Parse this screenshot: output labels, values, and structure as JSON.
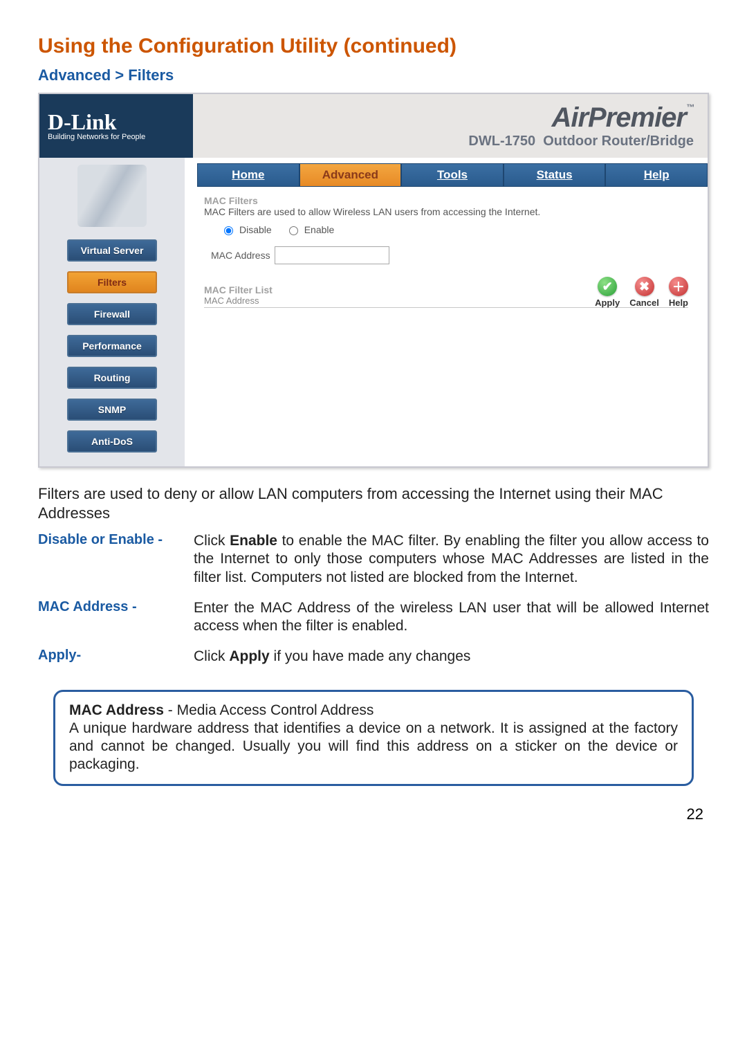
{
  "page_title": "Using the Configuration Utility (continued)",
  "breadcrumb": "Advanced > Filters",
  "logo": {
    "main": "D-Link",
    "sub": "Building Networks for People"
  },
  "brand": {
    "line1": "AirPremier",
    "model": "DWL-1750",
    "desc": "Outdoor Router/Bridge"
  },
  "tabs": [
    "Home",
    "Advanced",
    "Tools",
    "Status",
    "Help"
  ],
  "active_tab": "Advanced",
  "sidebar": [
    "Virtual Server",
    "Filters",
    "Firewall",
    "Performance",
    "Routing",
    "SNMP",
    "Anti-DoS"
  ],
  "sidebar_active": "Filters",
  "mac": {
    "heading": "MAC Filters",
    "desc": "MAC Filters are used to allow Wireless LAN users from accessing the Internet.",
    "disable": "Disable",
    "enable": "Enable",
    "addr_label": "MAC Address",
    "list_heading": "MAC Filter List",
    "list_sub": "MAC Address"
  },
  "actions": {
    "apply": "Apply",
    "cancel": "Cancel",
    "help": "Help"
  },
  "intro": "Filters are used to deny or allow LAN computers from accessing the Internet using their MAC Addresses",
  "defs": {
    "de_label": "Disable or Enable -",
    "de_text_a": "Click ",
    "de_text_bold": "Enable",
    "de_text_b": " to enable the MAC filter. By enabling the filter you allow access to the Internet to only those computers whose MAC Addresses are listed in the filter list. Computers not listed are blocked from the Internet.",
    "mac_label": "MAC Address -",
    "mac_text": "Enter the MAC Address of the wireless LAN user that will be allowed Internet access when the filter is enabled.",
    "apply_label": "Apply-",
    "apply_text_a": "Click ",
    "apply_text_bold": "Apply",
    "apply_text_b": " if you have made any changes"
  },
  "infobox": {
    "bold": "MAC Address",
    "rest": " - Media Access Control Address",
    "body": "A unique hardware address that identifies a device on a network. It is assigned at the factory and cannot be changed. Usually you will find this address on a sticker on the device or packaging."
  },
  "page_number": "22"
}
